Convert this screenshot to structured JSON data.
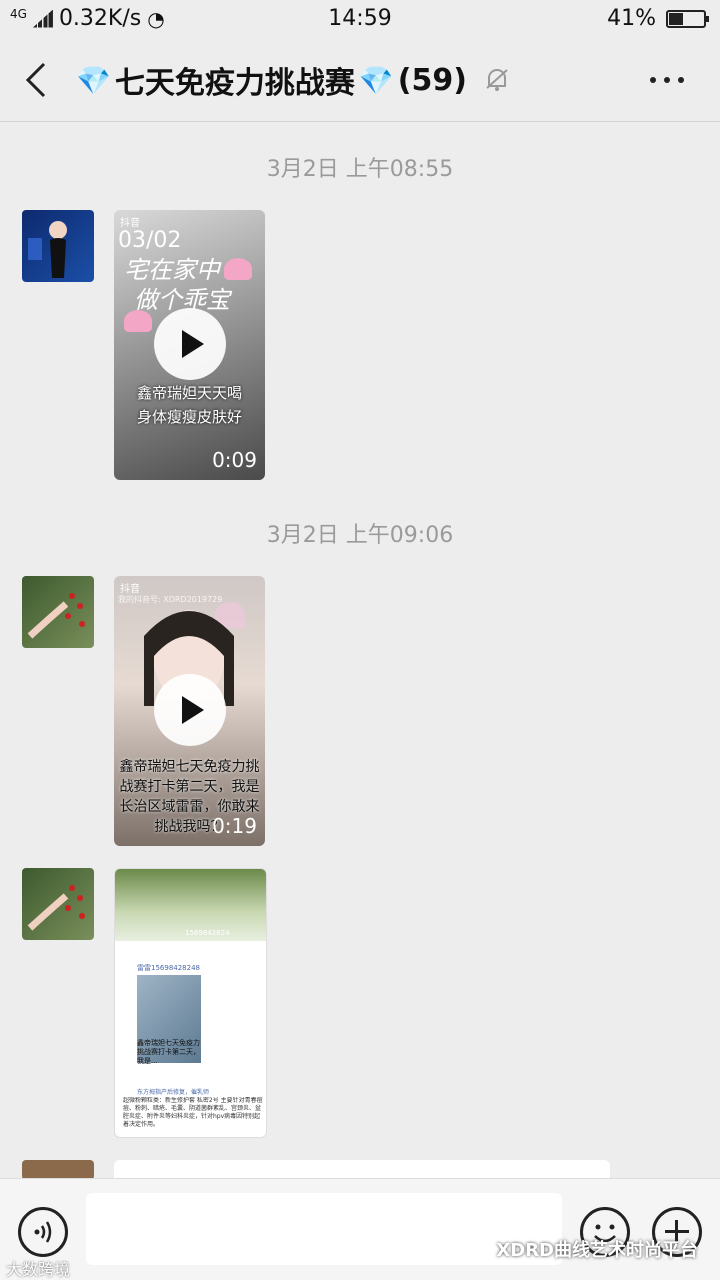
{
  "status": {
    "network": "4G",
    "speed": "0.32K/s",
    "time": "14:59",
    "battery": "41%",
    "battery_level": 0.41
  },
  "nav": {
    "gem_left": "💎",
    "title": "七天免疫力挑战赛",
    "gem_right": "💎",
    "count": "(59)"
  },
  "messages": [
    {
      "timestamp": "3月2日 上午08:55",
      "video": {
        "brand": "抖音",
        "overlay_top": "03/02",
        "line1": "宅在家中",
        "line2": "做个乖宝",
        "caption1": "鑫帝瑞妲天天喝",
        "caption2": "身体瘦瘦皮肤好",
        "duration": "0:09"
      }
    },
    {
      "timestamp": "3月2日 上午09:06",
      "video": {
        "brand": "抖音",
        "id": "我的抖音号: XDRD2019729",
        "caption1": "鑫帝瑞妲七天免疫力挑",
        "caption2": "战赛打卡第二天，我是",
        "caption3": "长治区域雷雷，你敢来",
        "caption4": "挑战我吗？",
        "duration": "0:19"
      }
    },
    {
      "image": {
        "phone": "1569842824",
        "name": "雷雷15698428248",
        "post": "鑫帝瑞妲七天免疫力挑战赛打卡第二天，我是...",
        "footer_title": "东方拇指产后修复，催乳师",
        "footer_text": "超微粉颗粒类：新生修护套 私密2号 主要针对青春痘痘、粉刺、暗疮、毛囊、阴道菌群紊乱、宫颈炎、盆腔炎症、附件炎等妇科炎症，针对hpv病毒因特别起着决定作用。"
      }
    }
  ],
  "watermark": {
    "left": "大数跨境",
    "right": "XDRD曲线艺术时尚平台"
  }
}
